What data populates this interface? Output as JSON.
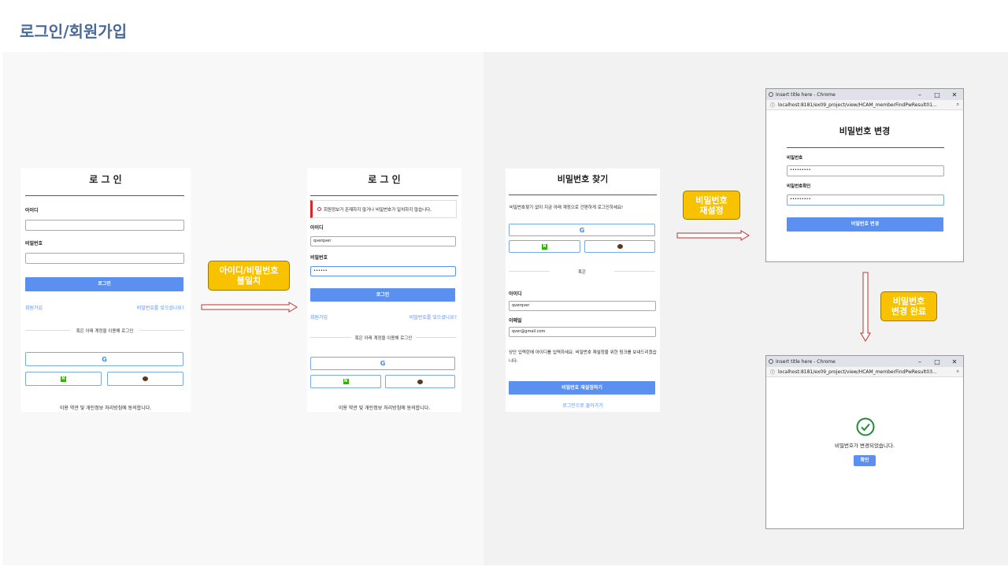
{
  "page_title": "로그인/회원가입",
  "login": {
    "title": "로 그 인",
    "id_label": "아이디",
    "pw_label": "비밀번호",
    "login_btn": "로그인",
    "signup": "회원가입",
    "forgot": "비밀번호를 잊으셨나요?",
    "social_sep": "혹은 아래 계정을 이용해 로그인",
    "google": "G",
    "naver": "N",
    "terms": "이용 약관 및 개인정보 처리방침에 동의합니다."
  },
  "login_error": {
    "error_msg": "회원정보가 존재하지 않거나 비밀번호가 일치하지 않습니다.",
    "id_value": "qverqver",
    "pw_value": "••••••"
  },
  "find_pw": {
    "title": "비밀번호 찾기",
    "desc": "비밀번호찾기 없이 지금 아래 계정으로 간편하게 로그인하세요!",
    "or": "혹은",
    "id_label": "아이디",
    "id_value": "qverqver",
    "email_label": "이메일",
    "email_value": "qver@gmail.com",
    "info": "상단 입력란에 아이디를 입력하세요. 비밀번호 재설정을 위한 링크를 보내드리겠습니다.",
    "reset_btn": "비밀번호 재설정하기",
    "back_link": "로그인으로 돌아가기"
  },
  "notes": {
    "mismatch": "아이디/비밀번호\n불일치",
    "reset": "비밀번호\n재설정",
    "complete": "비밀번호\n변경 완료"
  },
  "window": {
    "title": "Insert title here - Chrome",
    "url1": "localhost:8181/ex09_project/view/HCAM_memberFindPwResult01...",
    "url2": "localhost:8181/ex09_project/view/HCAM_memberFindPwResult03..."
  },
  "change_pw": {
    "title": "비밀번호 변경",
    "pw_label": "비밀번호",
    "pw_value": "•••••••••",
    "pw_confirm_label": "비밀번호확인",
    "pw_confirm_value": "•••••••••",
    "btn": "비밀번호 변경"
  },
  "complete": {
    "msg": "비밀번호가 변경되었습니다.",
    "ok": "확인"
  },
  "colors": {
    "accent": "#5b8ff0",
    "note": "#f8c200",
    "error": "#d8262b",
    "arrow": "#c0302a"
  }
}
